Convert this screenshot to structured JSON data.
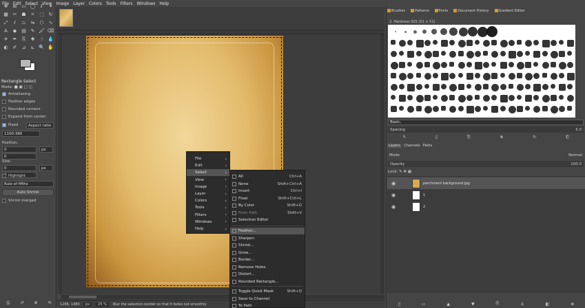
{
  "menubar": [
    "File",
    "Edit",
    "Select",
    "View",
    "Image",
    "Layer",
    "Colors",
    "Tools",
    "Filters",
    "Windows",
    "Help"
  ],
  "tool_options": {
    "title": "Rectangle Select",
    "mode_label": "Mode:",
    "antialiasing": "Antialiasing",
    "feather_edges": "Feather edges",
    "rounded_corners": "Rounded corners",
    "expand_from_center": "Expand from center",
    "fixed_label": "Fixed",
    "fixed_value": "Aspect ratio",
    "ratio_value": "1100:380",
    "position_label": "Position:",
    "pos_x": "0",
    "pos_y": "0",
    "pos_unit": "px",
    "size_label": "Size:",
    "size_w": "0",
    "size_h": "0",
    "size_unit": "px",
    "highlight": "Highlight",
    "guides_value": "Rule of fifths",
    "auto_shrink": "Auto Shrink",
    "shrink_merged": "Shrink merged"
  },
  "status": {
    "coords": "1288, 1480",
    "unit": "px",
    "zoom": "25 %",
    "message": "Blur the selection border so that it fades out smoothly"
  },
  "context_menu": [
    {
      "label": "File"
    },
    {
      "label": "Edit"
    },
    {
      "label": "Select",
      "highlight": true
    },
    {
      "label": "View"
    },
    {
      "label": "Image"
    },
    {
      "label": "Layer"
    },
    {
      "label": "Colors"
    },
    {
      "label": "Tools"
    },
    {
      "label": "Filters"
    },
    {
      "label": "Windows"
    },
    {
      "label": "Help"
    }
  ],
  "select_menu": [
    {
      "label": "All",
      "acc": "Ctrl+A"
    },
    {
      "label": "None",
      "acc": "Shift+Ctrl+A"
    },
    {
      "label": "Invert",
      "acc": "Ctrl+I"
    },
    {
      "label": "Float",
      "acc": "Shift+Ctrl+L"
    },
    {
      "label": "By Color",
      "acc": "Shift+O"
    },
    {
      "label": "From Path",
      "acc": "Shift+V",
      "disabled": true
    },
    {
      "label": "Selection Editor",
      "acc": ""
    },
    {
      "label": "Feather...",
      "acc": "",
      "highlight": true
    },
    {
      "label": "Sharpen",
      "acc": ""
    },
    {
      "label": "Shrink...",
      "acc": ""
    },
    {
      "label": "Grow...",
      "acc": ""
    },
    {
      "label": "Border...",
      "acc": ""
    },
    {
      "label": "Remove Holes",
      "acc": ""
    },
    {
      "label": "Distort...",
      "acc": ""
    },
    {
      "label": "Rounded Rectangle...",
      "acc": ""
    },
    {
      "label": "Toggle Quick Mask",
      "acc": "Shift+Q"
    },
    {
      "label": "Save to Channel",
      "acc": ""
    },
    {
      "label": "To Path",
      "acc": ""
    }
  ],
  "dock": {
    "tabs": [
      "Brushes",
      "Patterns",
      "Fonts",
      "Document History",
      "Gradient Editor"
    ],
    "brush_name": "2. Hardness 025 (51 × 51)",
    "filter_value": "Basic,",
    "spacing_label": "Spacing",
    "spacing_value": "5.0",
    "layers_tabs": [
      "Layers",
      "Channels",
      "Paths"
    ],
    "mode_label": "Mode",
    "mode_value": "Normal",
    "opacity_label": "Opacity",
    "opacity_value": "100.0",
    "lock_label": "Lock:",
    "layers": [
      {
        "name": "parchment background.jpg",
        "thumb": "#d9a84f"
      },
      {
        "name": "1",
        "thumb": "#ffffff"
      },
      {
        "name": "2",
        "thumb": "#ffffff"
      }
    ]
  }
}
